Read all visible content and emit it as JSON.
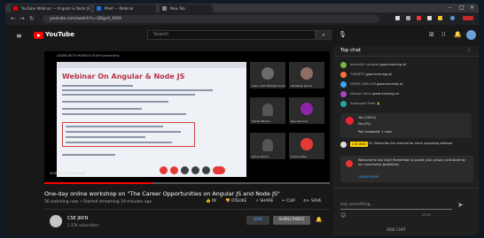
{
  "browser": {
    "tabs": [
      {
        "label": "YouTube Webinar — Angular & Node JS"
      },
      {
        "label": "Meet — Webinar"
      },
      {
        "label": "New Tab"
      }
    ],
    "url": "youtube.com/watch?v=Q6gcA_0ltfA"
  },
  "youtube": {
    "brand": "YouTube",
    "search_placeholder": "Search"
  },
  "meeting": {
    "top_banner": "LEARN WITH MAHESH DOSHI presenting",
    "slide_title": "Webinar On Angular & Node JS",
    "participants": [
      {
        "name": "Learn with Mahesh Doshi"
      },
      {
        "name": "Abhishek Kumar"
      },
      {
        "name": "Sakshi Mishra"
      },
      {
        "name": "Ravi Sharma"
      },
      {
        "name": "Rahul Verma"
      },
      {
        "name": "Sneha Patel"
      }
    ],
    "time_label": "4:00 PM | Ecu-rhyt-pwe"
  },
  "player": {
    "progress_fraction": 0.38
  },
  "video": {
    "title": "One-day online workshop on \"The Career Opportunities on Angular JS and Node JS\"",
    "meta": "30 watching now • Started streaming 19 minutes ago",
    "actions": {
      "like": "IN",
      "dislike": "DISLIKE",
      "share": "SHARE",
      "clip": "CLIP",
      "save": "SAVE"
    }
  },
  "channel": {
    "name": "CSE JKKN",
    "subs": "1.37K subscribers",
    "join": "JOIN",
    "subscribe": "SUBSCRIBED"
  },
  "chat": {
    "header": "Top chat",
    "messages": [
      {
        "author": "Jeevanith sangeet",
        "text": "good evening sir",
        "color": "#7cb342"
      },
      {
        "author": "THENPTS",
        "text": "good evening sir",
        "color": "#ff7043"
      },
      {
        "author": "DEEPA DHILLON",
        "text": "good evening sir",
        "color": "#42a5f5"
      },
      {
        "author": "Nishant Shire",
        "text": "good evening sir",
        "color": "#ab47bc"
      },
      {
        "author": "Sowmyalil Preet",
        "text": "🙏",
        "color": "#26a69a"
      }
    ],
    "poll": {
      "line1": "Yes (100%)",
      "line2": "No (0%)",
      "line3": "Poll complete: 1 vote"
    },
    "system": {
      "badge": "CSE JKKN",
      "text": "Hi, Subscribe the channel for more upcoming webinar"
    },
    "reminder": {
      "text": "Welcome to live chat! Remember to guard your privacy and abide by our community guidelines.",
      "link": "LEARN MORE"
    },
    "input_placeholder": "Say something...",
    "char_count": "0/200",
    "hide": "HIDE CHAT"
  }
}
